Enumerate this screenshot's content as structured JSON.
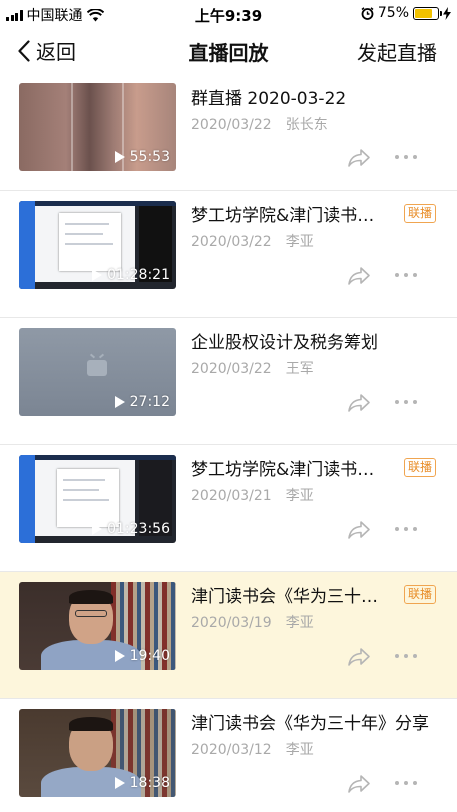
{
  "status_bar": {
    "carrier": "中国联通",
    "time": "上午9:39",
    "battery_percent": "75%",
    "battery_level": 0.75
  },
  "nav": {
    "back_label": "返回",
    "title": "直播回放",
    "action_label": "发起直播"
  },
  "items": [
    {
      "title": "群直播 2020-03-22",
      "date": "2020/03/22",
      "author": "张长东",
      "duration": "55:53",
      "badge": ""
    },
    {
      "title": "梦工坊学院&津门读书会《华为三十年》",
      "date": "2020/03/22",
      "author": "李亚",
      "duration": "01:28:21",
      "badge": "联播"
    },
    {
      "title": "企业股权设计及税务筹划",
      "date": "2020/03/22",
      "author": "王军",
      "duration": "27:12",
      "badge": ""
    },
    {
      "title": "梦工坊学院&津门读书会《华为三十年》",
      "date": "2020/03/21",
      "author": "李亚",
      "duration": "01:23:56",
      "badge": "联播"
    },
    {
      "title": "津门读书会《华为三十年》",
      "date": "2020/03/19",
      "author": "李亚",
      "duration": "19:40",
      "badge": "联播"
    },
    {
      "title": "津门读书会《华为三十年》分享",
      "date": "2020/03/12",
      "author": "李亚",
      "duration": "18:38",
      "badge": ""
    }
  ],
  "colors": {
    "highlight_row": "#fdf6dc",
    "badge": "#e88e2a",
    "meta_text": "#a9a9a9"
  },
  "icons": {
    "back": "chevron-left-icon",
    "share": "share-arrow-icon",
    "more": "more-dots-icon",
    "play": "play-icon",
    "wifi": "wifi-icon",
    "alarm": "alarm-icon",
    "charging": "charging-bolt-icon"
  }
}
